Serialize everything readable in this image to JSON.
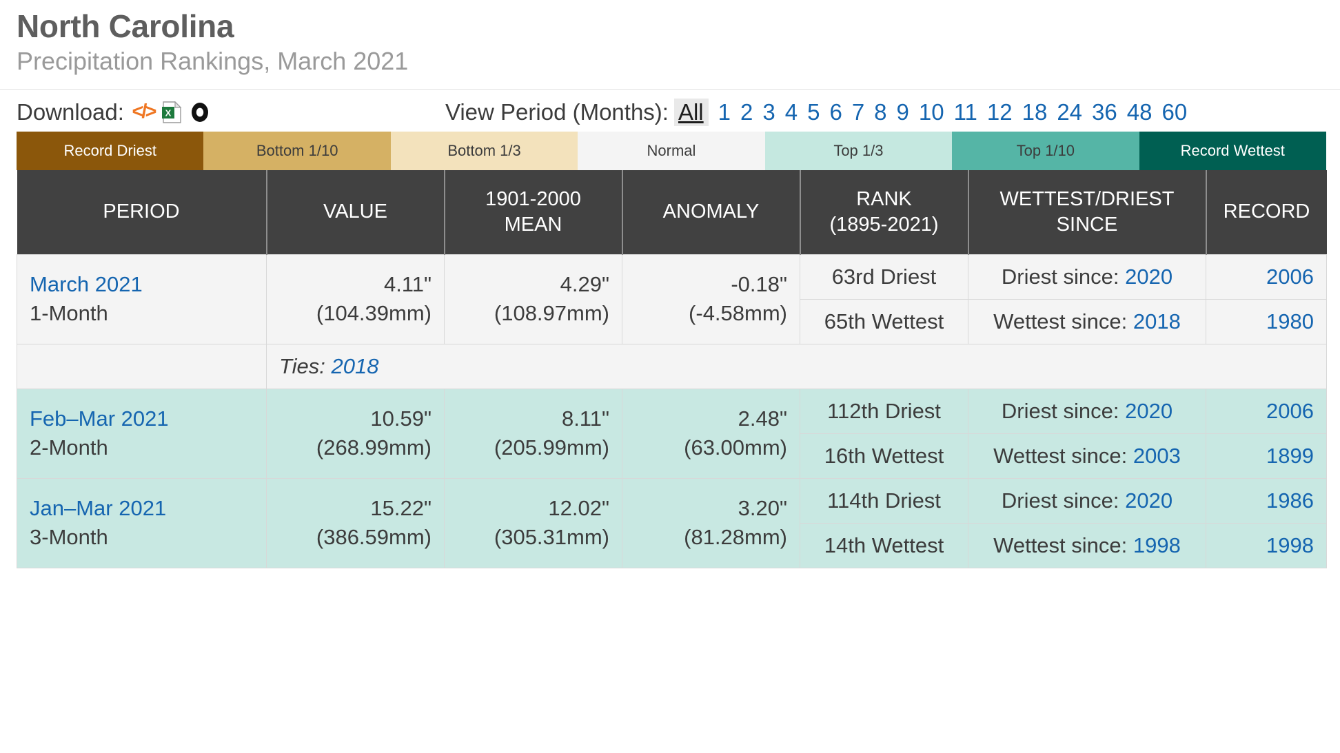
{
  "header": {
    "title": "North Carolina",
    "subtitle": "Precipitation Rankings, March 2021"
  },
  "toolbar": {
    "download_label": "Download:",
    "download_icons": [
      "code-icon",
      "excel-icon",
      "print-icon"
    ],
    "view_period_label": "View Period (Months):",
    "view_period_selected": "All",
    "view_period_options": [
      "1",
      "2",
      "3",
      "4",
      "5",
      "6",
      "7",
      "8",
      "9",
      "10",
      "11",
      "12",
      "18",
      "24",
      "36",
      "48",
      "60"
    ]
  },
  "legend": [
    {
      "label": "Record Driest",
      "color": "#8b570b",
      "text": "light"
    },
    {
      "label": "Bottom 1/10",
      "color": "#d5b164",
      "text": "dark"
    },
    {
      "label": "Bottom 1/3",
      "color": "#f3e2bc",
      "text": "dark"
    },
    {
      "label": "Normal",
      "color": "#f4f4f4",
      "text": "dark"
    },
    {
      "label": "Top 1/3",
      "color": "#c5e8e0",
      "text": "dark"
    },
    {
      "label": "Top 1/10",
      "color": "#55b5a6",
      "text": "dark"
    },
    {
      "label": "Record Wettest",
      "color": "#005f52",
      "text": "light"
    }
  ],
  "table": {
    "columns": [
      "PERIOD",
      "VALUE",
      "1901-2000\nMEAN",
      "ANOMALY",
      "RANK\n(1895-2021)",
      "WETTEST/DRIEST\nSINCE",
      "RECORD"
    ],
    "columns_split": [
      {
        "line1": "PERIOD",
        "line2": ""
      },
      {
        "line1": "VALUE",
        "line2": ""
      },
      {
        "line1": "1901-2000",
        "line2": "MEAN"
      },
      {
        "line1": "ANOMALY",
        "line2": ""
      },
      {
        "line1": "RANK",
        "line2": "(1895-2021)"
      },
      {
        "line1": "WETTEST/DRIEST",
        "line2": "SINCE"
      },
      {
        "line1": "RECORD",
        "line2": ""
      }
    ],
    "rows": [
      {
        "bg": "normal",
        "period_label": "March 2021",
        "period_sub": "1-Month",
        "value_in": "4.11\"",
        "value_mm": "(104.39mm)",
        "mean_in": "4.29\"",
        "mean_mm": "(108.97mm)",
        "anomaly_in": "-0.18\"",
        "anomaly_mm": "(-4.58mm)",
        "rank_driest": "63rd Driest",
        "since_driest_label": "Driest since:",
        "since_driest_year": "2020",
        "record_driest": "2006",
        "rank_wettest": "65th Wettest",
        "since_wettest_label": "Wettest since:",
        "since_wettest_year": "2018",
        "record_wettest": "1980",
        "ties_label": "Ties:",
        "ties_years": "2018"
      },
      {
        "bg": "top13",
        "period_label": "Feb–Mar 2021",
        "period_sub": "2-Month",
        "value_in": "10.59\"",
        "value_mm": "(268.99mm)",
        "mean_in": "8.11\"",
        "mean_mm": "(205.99mm)",
        "anomaly_in": "2.48\"",
        "anomaly_mm": "(63.00mm)",
        "rank_driest": "112th Driest",
        "since_driest_label": "Driest since:",
        "since_driest_year": "2020",
        "record_driest": "2006",
        "rank_wettest": "16th Wettest",
        "since_wettest_label": "Wettest since:",
        "since_wettest_year": "2003",
        "record_wettest": "1899",
        "ties_label": null,
        "ties_years": null
      },
      {
        "bg": "top13",
        "period_label": "Jan–Mar 2021",
        "period_sub": "3-Month",
        "value_in": "15.22\"",
        "value_mm": "(386.59mm)",
        "mean_in": "12.02\"",
        "mean_mm": "(305.31mm)",
        "anomaly_in": "3.20\"",
        "anomaly_mm": "(81.28mm)",
        "rank_driest": "114th Driest",
        "since_driest_label": "Driest since:",
        "since_driest_year": "2020",
        "record_driest": "1986",
        "rank_wettest": "14th Wettest",
        "since_wettest_label": "Wettest since:",
        "since_wettest_year": "1998",
        "record_wettest": "1998",
        "ties_label": null,
        "ties_years": null
      }
    ]
  },
  "colors": {
    "link": "#1565b0",
    "header_bg": "#414141",
    "text": "#3c3c3c",
    "title": "#5e5e5e",
    "subtitle": "#9a9a9a"
  }
}
